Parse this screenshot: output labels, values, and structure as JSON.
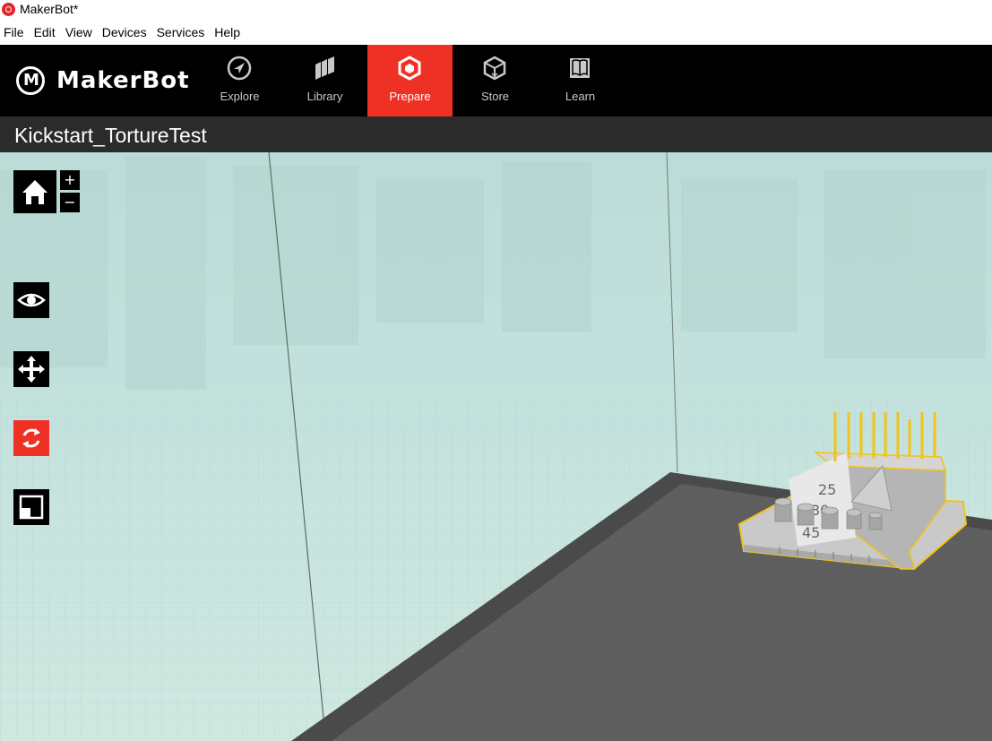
{
  "window": {
    "title": "MakerBot*"
  },
  "menu": [
    "File",
    "Edit",
    "View",
    "Devices",
    "Services",
    "Help"
  ],
  "brand": {
    "name": "MakerBot"
  },
  "nav": [
    {
      "label": "Explore",
      "icon": "compass-icon"
    },
    {
      "label": "Library",
      "icon": "library-icon"
    },
    {
      "label": "Prepare",
      "icon": "prepare-icon",
      "active": true
    },
    {
      "label": "Store",
      "icon": "store-icon"
    },
    {
      "label": "Learn",
      "icon": "learn-icon"
    }
  ],
  "project": {
    "name": "Kickstart_TortureTest"
  },
  "tools": {
    "home": "home-icon",
    "zoom_in": "+",
    "zoom_out": "−",
    "view": "eye-icon",
    "move": "move-icon",
    "rotate": "rotate-icon",
    "scale": "scale-icon"
  },
  "model": {
    "labels": [
      "25",
      "30",
      "45"
    ]
  },
  "colors": {
    "accent": "#ef3125",
    "topbar": "#000000",
    "build_plate": "#5a5a5a",
    "selection": "#f0c419"
  }
}
